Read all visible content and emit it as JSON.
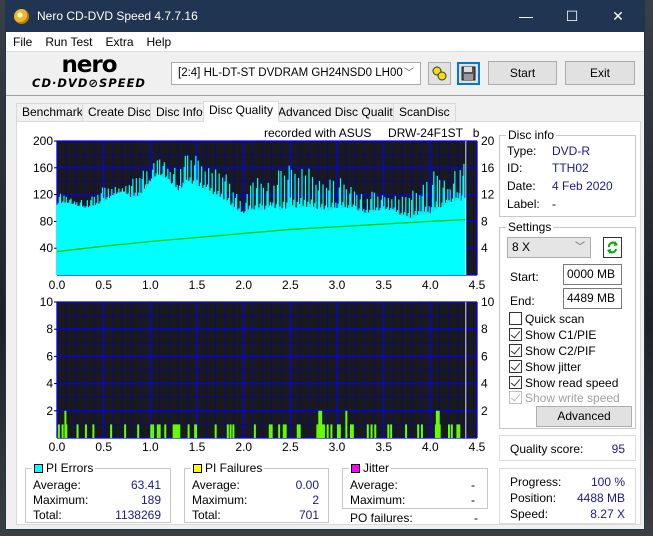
{
  "window": {
    "title": "Nero CD-DVD Speed 4.7.7.16",
    "controls": {
      "minimize": "—",
      "maximize": "☐",
      "close": "✕"
    }
  },
  "menu": [
    "File",
    "Run Test",
    "Extra",
    "Help"
  ],
  "toolbar": {
    "logo_top": "nero",
    "logo_bottom": "CD·DVD⊘SPEED",
    "drive": "[2:4]  HL-DT-ST DVDRAM GH24NSD0 LH00",
    "start_label": "Start",
    "exit_label": "Exit",
    "icons": [
      "drive-config-icon",
      "save-icon"
    ]
  },
  "tabs": [
    {
      "label": "Benchmark",
      "active": false
    },
    {
      "label": "Create Disc",
      "active": false
    },
    {
      "label": "Disc Info",
      "active": false
    },
    {
      "label": "Disc Quality",
      "active": true
    },
    {
      "label": "Advanced Disc Quality",
      "active": false
    },
    {
      "label": "ScanDisc",
      "active": false
    }
  ],
  "recorded_with": "recorded with ASUS     DRW-24F1ST   b",
  "disc_info": {
    "title": "Disc info",
    "type_label": "Type:",
    "type": "DVD-R",
    "id_label": "ID:",
    "id": "TTH02",
    "date_label": "Date:",
    "date": "4 Feb 2020",
    "label_label": "Label:",
    "label": "-"
  },
  "settings": {
    "title": "Settings",
    "speed": "8 X",
    "start_label": "Start:",
    "start": "0000 MB",
    "end_label": "End:",
    "end": "4489 MB",
    "checkboxes": [
      {
        "label": "Quick scan",
        "checked": false,
        "disabled": false
      },
      {
        "label": "Show C1/PIE",
        "checked": true,
        "disabled": false
      },
      {
        "label": "Show C2/PIF",
        "checked": true,
        "disabled": false
      },
      {
        "label": "Show jitter",
        "checked": true,
        "disabled": false
      },
      {
        "label": "Show read speed",
        "checked": true,
        "disabled": false
      },
      {
        "label": "Show write speed",
        "checked": true,
        "disabled": true
      }
    ],
    "advanced_label": "Advanced"
  },
  "quality": {
    "label": "Quality score:",
    "value": "95"
  },
  "progress": {
    "progress_label": "Progress:",
    "progress": "100 %",
    "position_label": "Position:",
    "position": "4488 MB",
    "speed_label": "Speed:",
    "speed": "8.27 X"
  },
  "pi_errors": {
    "title": "PI Errors",
    "color": "#00ffff",
    "average_label": "Average:",
    "average": "63.41",
    "maximum_label": "Maximum:",
    "maximum": "189",
    "total_label": "Total:",
    "total": "1138269"
  },
  "pi_failures": {
    "title": "PI Failures",
    "color": "#ffff00",
    "average_label": "Average:",
    "average": "0.00",
    "maximum_label": "Maximum:",
    "maximum": "2",
    "total_label": "Total:",
    "total": "701"
  },
  "jitter": {
    "title": "Jitter",
    "color": "#ff00ff",
    "average_label": "Average:",
    "average": "-",
    "maximum_label": "Maximum:",
    "maximum": "-"
  },
  "po_failures": {
    "label": "PO failures:",
    "value": "-"
  },
  "chart_data": [
    {
      "type": "bar",
      "name": "PI Errors / Read speed",
      "xlabel": "",
      "ylabel": "",
      "xlim": [
        0,
        4.5
      ],
      "ylim": [
        0,
        200
      ],
      "y2lim": [
        0,
        20
      ],
      "x_ticks": [
        "0.0",
        "0.5",
        "1.0",
        "1.5",
        "2.0",
        "2.5",
        "3.0",
        "3.5",
        "4.0",
        "4.5"
      ],
      "y_ticks": [
        "200",
        "160",
        "120",
        "80",
        "40"
      ],
      "y2_ticks": [
        "20",
        "16",
        "12",
        "8",
        "4"
      ],
      "grid": true,
      "series": [
        {
          "name": "PI Errors",
          "color": "#00ffff",
          "x": [
            0.0,
            0.1,
            0.2,
            0.3,
            0.4,
            0.5,
            0.6,
            0.7,
            0.8,
            0.9,
            1.0,
            1.1,
            1.2,
            1.3,
            1.4,
            1.5,
            1.6,
            1.7,
            1.8,
            1.9,
            2.0,
            2.1,
            2.2,
            2.3,
            2.4,
            2.5,
            2.6,
            2.7,
            2.8,
            2.9,
            3.0,
            3.1,
            3.2,
            3.3,
            3.4,
            3.5,
            3.6,
            3.7,
            3.8,
            3.9,
            4.0,
            4.1,
            4.2,
            4.3,
            4.38
          ],
          "values": [
            105,
            108,
            104,
            100,
            103,
            110,
            118,
            125,
            115,
            118,
            140,
            150,
            140,
            125,
            140,
            132,
            128,
            118,
            112,
            98,
            92,
            98,
            96,
            102,
            96,
            102,
            100,
            102,
            98,
            95,
            100,
            100,
            98,
            92,
            95,
            98,
            96,
            88,
            85,
            90,
            92,
            100,
            108,
            112,
            110
          ],
          "peaks": [
            125,
            120,
            110,
            115,
            120,
            135,
            136,
            130,
            145,
            158,
            162,
            182,
            160,
            165,
            188,
            182,
            170,
            162,
            158,
            130,
            105,
            155,
            145,
            140,
            170,
            170,
            175,
            165,
            145,
            145,
            155,
            140,
            130,
            120,
            130,
            120,
            125,
            120,
            130,
            132,
            162,
            160,
            130,
            178,
            170
          ]
        },
        {
          "name": "Read speed",
          "color": "#00cc00",
          "axis": "y2",
          "x": [
            0.0,
            0.5,
            1.0,
            1.5,
            2.0,
            2.5,
            3.0,
            3.5,
            4.0,
            4.38
          ],
          "values": [
            3.5,
            4.3,
            5.0,
            5.6,
            6.2,
            6.8,
            7.2,
            7.6,
            8.0,
            8.27
          ]
        }
      ]
    },
    {
      "type": "bar",
      "name": "PI Failures",
      "xlim": [
        0,
        4.5
      ],
      "ylim": [
        0,
        10
      ],
      "x_ticks": [
        "0.0",
        "0.5",
        "1.0",
        "1.5",
        "2.0",
        "2.5",
        "3.0",
        "3.5",
        "4.0",
        "4.5"
      ],
      "y_ticks": [
        "10",
        "8",
        "6",
        "4",
        "2"
      ],
      "y2_ticks": [
        "10",
        "8",
        "6",
        "4",
        "2"
      ],
      "grid": true,
      "series": [
        {
          "name": "PI Failures",
          "color": "#66ff00",
          "x": [
            0.02,
            0.06,
            0.09,
            0.1,
            0.22,
            0.31,
            0.39,
            0.58,
            0.73,
            0.87,
            1.01,
            1.03,
            1.08,
            1.1,
            1.16,
            1.25,
            1.27,
            1.29,
            1.31,
            1.41,
            1.48,
            1.49,
            1.7,
            1.83,
            1.86,
            1.89,
            2.12,
            2.28,
            2.3,
            2.38,
            2.43,
            2.45,
            2.58,
            2.6,
            2.79,
            2.81,
            2.82,
            2.83,
            2.85,
            2.86,
            2.9,
            2.94,
            3.01,
            3.03,
            3.1,
            3.15,
            3.17,
            3.33,
            3.37,
            3.41,
            3.55,
            3.58,
            3.74,
            3.87,
            3.91,
            4.06,
            4.07,
            4.08,
            4.09,
            4.1,
            4.2,
            4.23,
            4.29,
            4.31
          ],
          "values": [
            1,
            1,
            2,
            1,
            1,
            1,
            1,
            1,
            1,
            1,
            1,
            1,
            1,
            1,
            1,
            1,
            1,
            1,
            1,
            1,
            1,
            1,
            1,
            1,
            1,
            1,
            1,
            1,
            1,
            1,
            1,
            1,
            1,
            1,
            1,
            2,
            1,
            2,
            1,
            1,
            1,
            1,
            1,
            1,
            2,
            1,
            1,
            1,
            1,
            1,
            1,
            1,
            1,
            1,
            1,
            1,
            2,
            2,
            2,
            1,
            1,
            1,
            1,
            1
          ]
        }
      ]
    }
  ]
}
